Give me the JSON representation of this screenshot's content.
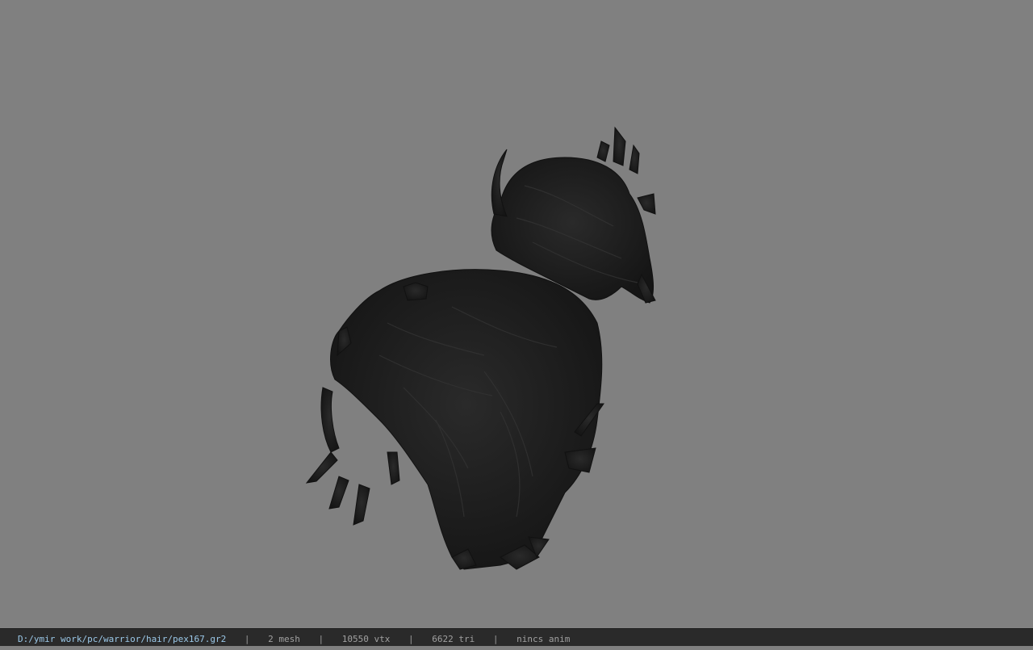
{
  "viewer": {
    "background_color": "#808080",
    "model_color": "#1c1c1c",
    "model_icon": "hair-mesh"
  },
  "statusbar": {
    "file_path": "D:/ymir work/pc/warrior/hair/pex167.gr2",
    "separator": "|",
    "mesh_count": "2 mesh",
    "vertex_count": "10550 vtx",
    "triangle_count": "6622 tri",
    "anim_info": "nincs anim",
    "path_color": "#9bc8e8",
    "bar_color": "#2a2a2a"
  }
}
